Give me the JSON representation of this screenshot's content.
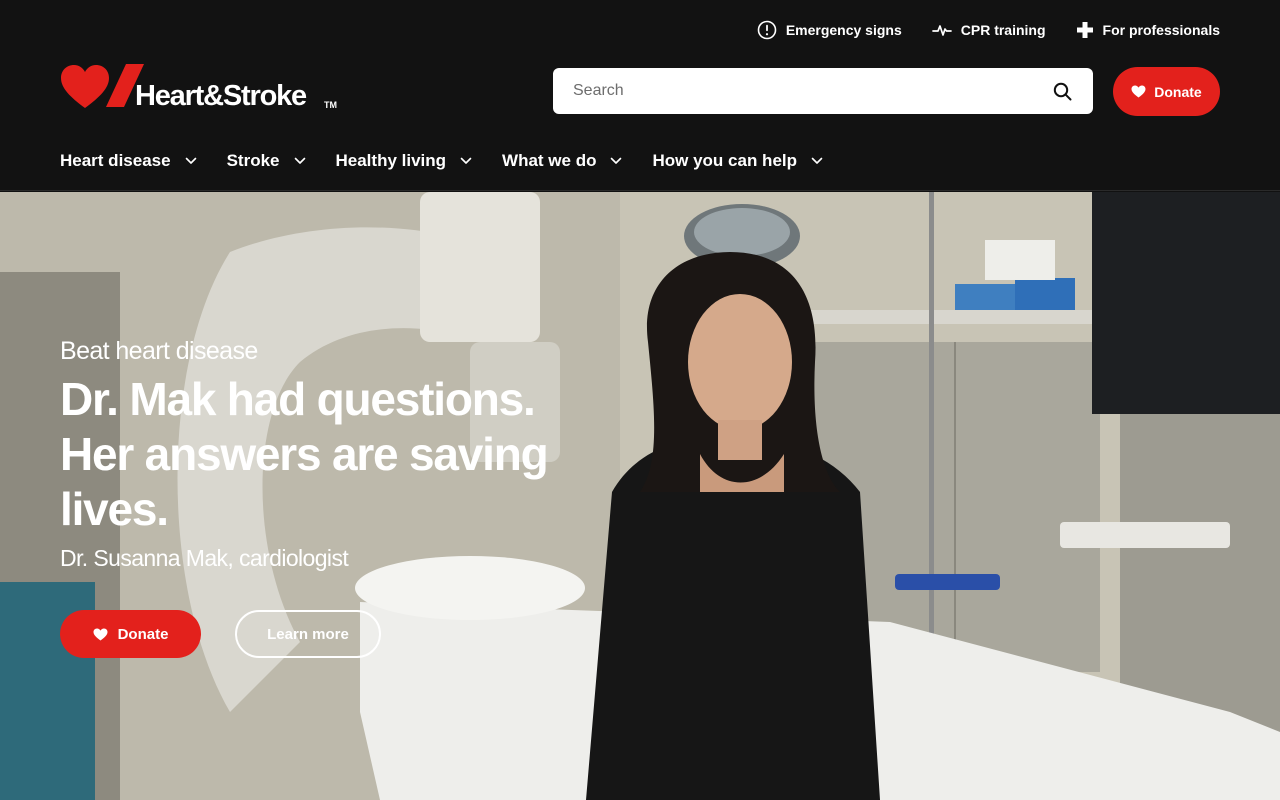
{
  "utility_nav": [
    {
      "label": "Emergency signs",
      "icon": "alert-circle-icon"
    },
    {
      "label": "CPR training",
      "icon": "heartbeat-icon"
    },
    {
      "label": "For professionals",
      "icon": "medical-cross-icon"
    }
  ],
  "brand": {
    "name": "Heart&Stroke",
    "trademark": "TM",
    "accent_color": "#e3211c"
  },
  "search": {
    "placeholder": "Search",
    "value": ""
  },
  "header_donate_label": "Donate",
  "main_nav": [
    {
      "label": "Heart disease"
    },
    {
      "label": "Stroke"
    },
    {
      "label": "Healthy living"
    },
    {
      "label": "What we do"
    },
    {
      "label": "How you can help"
    }
  ],
  "hero": {
    "eyebrow": "Beat heart disease",
    "headline_line1": "Dr. Mak had questions.",
    "headline_line2": "Her answers are saving",
    "headline_line3": "lives.",
    "byline": "Dr. Susanna Mak, cardiologist",
    "donate_label": "Donate",
    "learn_more_label": "Learn more"
  }
}
